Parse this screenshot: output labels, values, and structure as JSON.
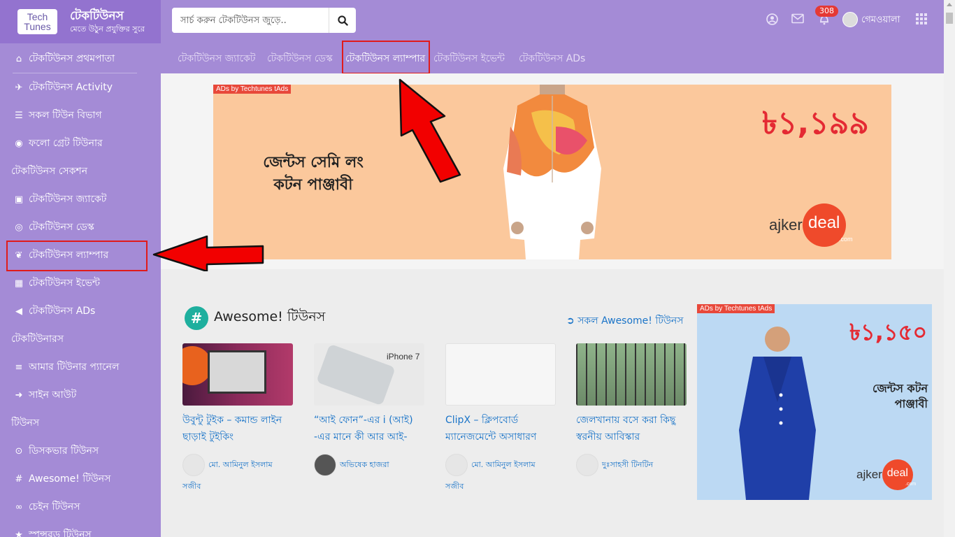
{
  "brand": {
    "logo_line1": "Tech",
    "logo_line2": "Tunes",
    "title": "টেকটিউনস",
    "tagline": "মেতে উঠুন প্রযুক্তির সুরে"
  },
  "search": {
    "placeholder": "সার্চ করুন টেকটিউনস জুড়ে.."
  },
  "header": {
    "notification_count": "308",
    "username": "গেমওয়ালা"
  },
  "sidebar": {
    "items": [
      {
        "icon": "home-icon",
        "label": "টেকটিউনস প্রথমপাতা"
      },
      {
        "icon": "plane-icon",
        "label": "টেকটিউনস Activity"
      },
      {
        "icon": "list-icon",
        "label": "সকল টিউন বিভাগ"
      },
      {
        "icon": "user-circle-icon",
        "label": "ফলো গ্রেট টিউনার"
      }
    ],
    "section1": "টেকটিউনস সেকশন",
    "section_items": [
      {
        "icon": "medkit-icon",
        "label": "টেকটিউনস জ্যাকেট"
      },
      {
        "icon": "lifebuoy-icon",
        "label": "টেকটিউনস ডেস্ক"
      },
      {
        "icon": "leaf-icon",
        "label": "টেকটিউনস ল্যাম্পার"
      },
      {
        "icon": "calendar-icon",
        "label": "টেকটিউনস ইভেন্ট"
      },
      {
        "icon": "bullhorn-icon",
        "label": "টেকটিউনস ADs"
      }
    ],
    "section2": "টেকটিউনারস",
    "tuner_items": [
      {
        "icon": "bars-icon",
        "label": "আমার টিউনার প্যানেল"
      },
      {
        "icon": "sign-out-icon",
        "label": "সাইন আউট"
      }
    ],
    "section3": "টিউনস",
    "tune_items": [
      {
        "icon": "compass-icon",
        "label": "ডিসকভার টিউনস"
      },
      {
        "icon": "hashtag-icon",
        "label": "Awesome! টিউনস"
      },
      {
        "icon": "chain-icon",
        "label": "চেইন টিউনস"
      },
      {
        "icon": "star-icon",
        "label": "স্পন্সরড টিউনস"
      }
    ]
  },
  "subnav": {
    "items": [
      "টেকটিউনস জ্যাকেট",
      "টেকটিউনস ডেস্ক",
      "টেকটিউনস ল্যাম্পার",
      "টেকটিউনস ইভেন্ট",
      "টেকটিউনস ADs"
    ],
    "active_index": 2
  },
  "banner_ad": {
    "tag": "ADs by Techtunes tAds",
    "text": "জেন্টস সেমি লং কটন পাঞ্জাবী",
    "price": "৳১,১৯৯",
    "logo_prefix": "ajker",
    "logo_badge": "deal",
    "logo_suffix": ".com"
  },
  "awesome": {
    "title": "Awesome! টিউনস",
    "see_all": "সকল Awesome! টিউনস",
    "cards": [
      {
        "title": "উবুন্টু টুইক – কমান্ড লাইন ছাড়াই টুইকিং",
        "author": "মো. আমিনুল ইসলাম",
        "author2": "সজীব"
      },
      {
        "title": "“আই ফোন”-এর i (আই) -এর মানে কী আর আই-",
        "author": "অভিষেক হাজরা",
        "author2": "",
        "image_label": "iPhone 7"
      },
      {
        "title": "ClipX – ক্লিপবোর্ড ম্যানেজমেন্টে অসাধারণ",
        "author": "মো. আমিনুল ইসলাম",
        "author2": "সজীব"
      },
      {
        "title": "জেলখানায় বসে করা কিছু স্বরনীয় আবিস্কার",
        "author": "দুঃসাহসী টিনটিন",
        "author2": ""
      }
    ]
  },
  "side_ad": {
    "tag": "ADs by Techtunes tAds",
    "price": "৳১,১৫০",
    "text": "জেন্টস কটন পাঞ্জাবী",
    "logo_prefix": "ajker",
    "logo_badge": "deal",
    "logo_suffix": ".com"
  },
  "colors": {
    "header_purple": "#a48bd6",
    "brand_purple": "#9373cf",
    "link_blue": "#1a74c8",
    "accent_teal": "#1eaf9e",
    "annotation_red": "#e01b1b"
  }
}
